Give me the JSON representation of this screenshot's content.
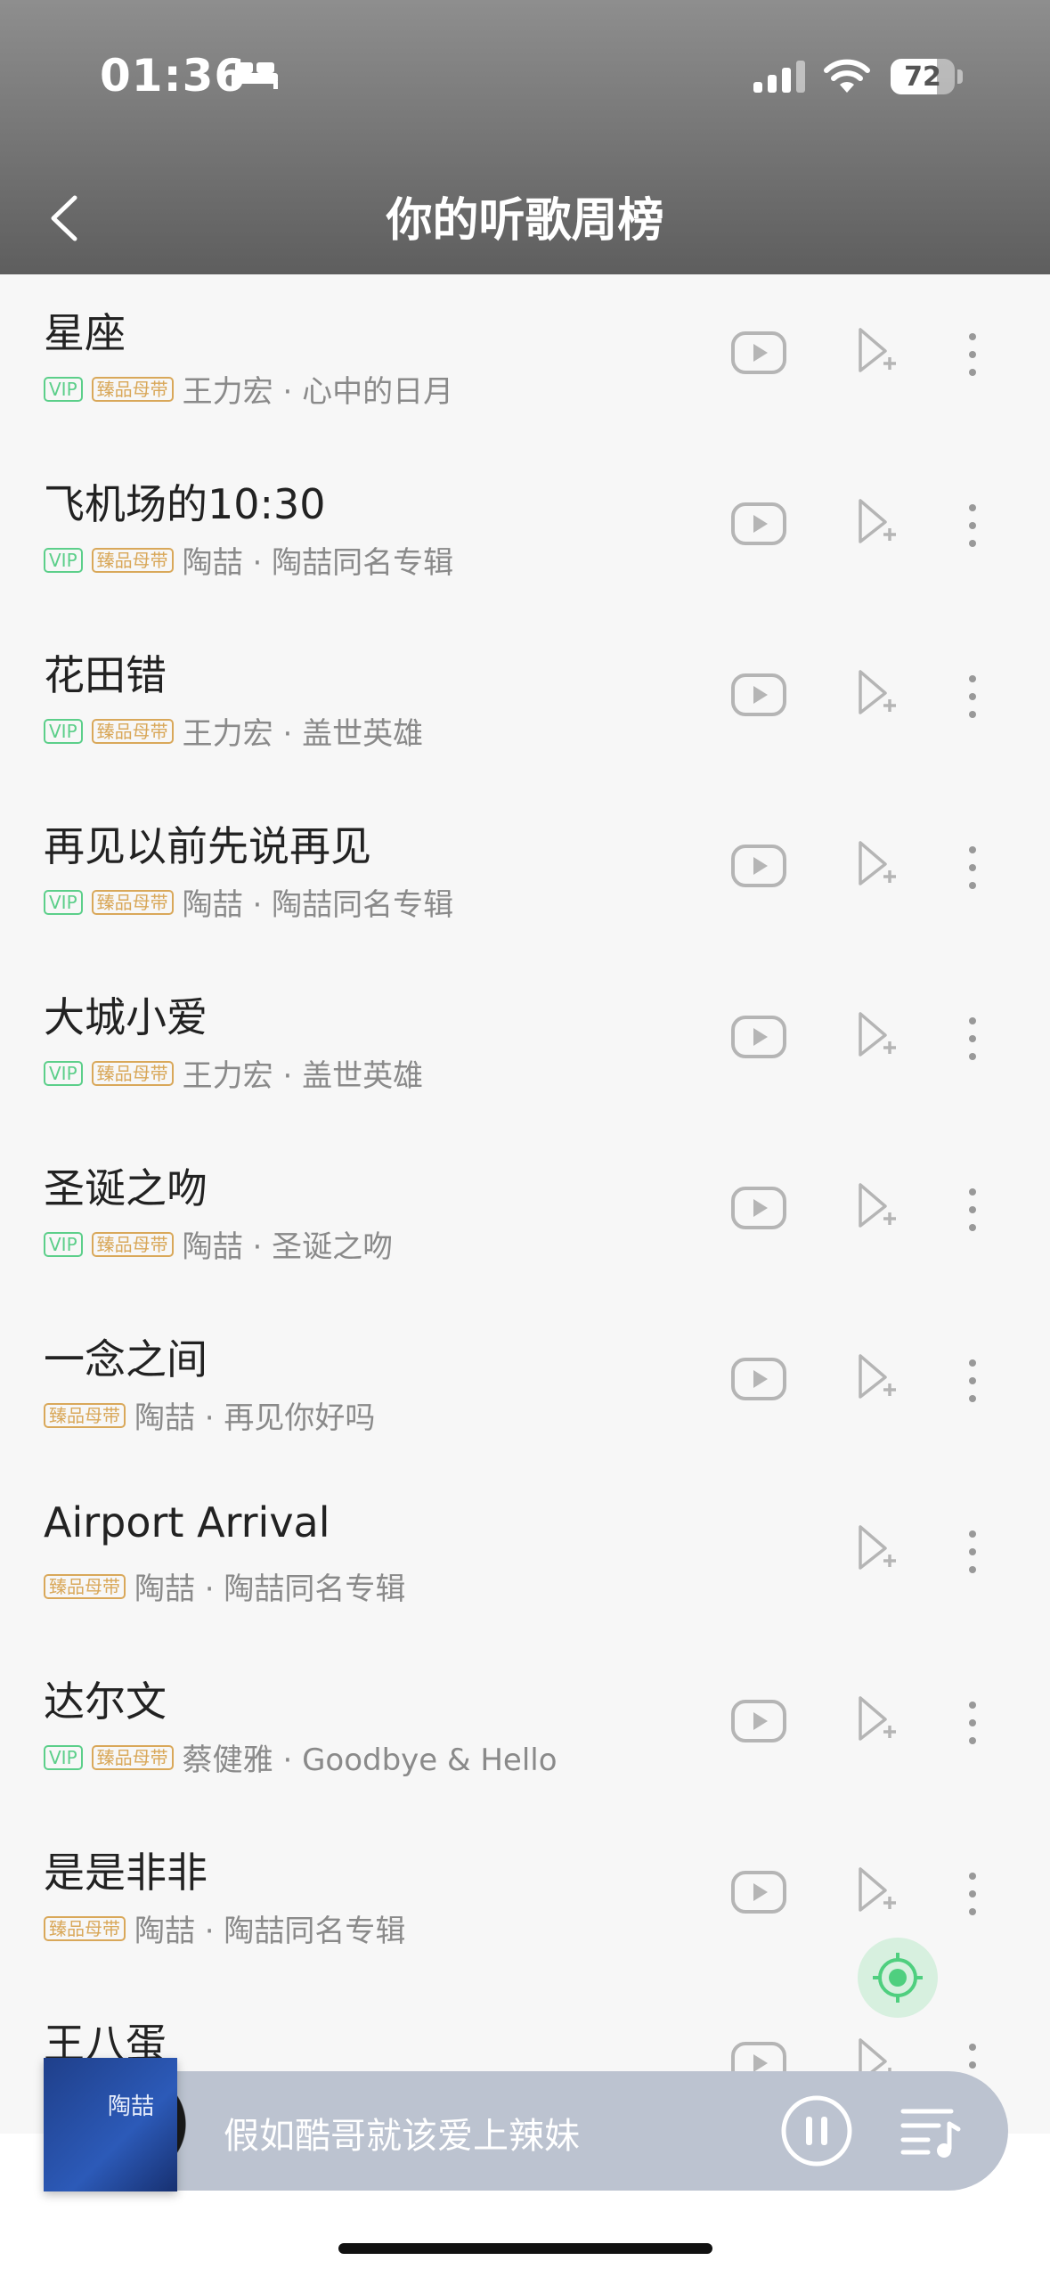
{
  "status_bar": {
    "time": "01:36",
    "battery": "72"
  },
  "header": {
    "title": "你的听歌周榜"
  },
  "songs": [
    {
      "title": "星座",
      "vip": "VIP",
      "master": "臻品母带",
      "subtitle": "王力宏 · 心中的日月",
      "has_mv": true
    },
    {
      "title": "飞机场的10:30",
      "vip": "VIP",
      "master": "臻品母带",
      "subtitle": "陶喆 · 陶喆同名专辑",
      "has_mv": true
    },
    {
      "title": "花田错",
      "vip": "VIP",
      "master": "臻品母带",
      "subtitle": "王力宏 · 盖世英雄",
      "has_mv": true
    },
    {
      "title": "再见以前先说再见",
      "vip": "VIP",
      "master": "臻品母带",
      "subtitle": "陶喆 · 陶喆同名专辑",
      "has_mv": true
    },
    {
      "title": "大城小爱",
      "vip": "VIP",
      "master": "臻品母带",
      "subtitle": "王力宏 · 盖世英雄",
      "has_mv": true
    },
    {
      "title": "圣诞之吻",
      "vip": "VIP",
      "master": "臻品母带",
      "subtitle": "陶喆 · 圣诞之吻",
      "has_mv": true
    },
    {
      "title": "一念之间",
      "vip": "",
      "master": "臻品母带",
      "subtitle": "陶喆 · 再见你好吗",
      "has_mv": true
    },
    {
      "title": "Airport Arrival",
      "vip": "",
      "master": "臻品母带",
      "subtitle": "陶喆 · 陶喆同名专辑",
      "has_mv": false
    },
    {
      "title": "达尔文",
      "vip": "VIP",
      "master": "臻品母带",
      "subtitle": "蔡健雅 · Goodbye & Hello",
      "has_mv": true
    },
    {
      "title": "是是非非",
      "vip": "",
      "master": "臻品母带",
      "subtitle": "陶喆 · 陶喆同名专辑",
      "has_mv": true
    },
    {
      "title": "王八蛋",
      "vip": "",
      "master": "",
      "subtitle": "",
      "has_mv": true
    }
  ],
  "player": {
    "now_playing": "假如酷哥就该爱上辣妹",
    "cover_text": "陶喆"
  },
  "icons": {
    "back": "chevron-left-icon",
    "mv": "video-play-icon",
    "add": "add-to-playlist-icon",
    "more": "more-vertical-icon",
    "locate": "locate-icon",
    "pause": "pause-icon",
    "playlist": "playlist-icon"
  },
  "colors": {
    "vip": "#5ccf8a",
    "master": "#d9a85a",
    "locate": "#4fcf7f"
  }
}
